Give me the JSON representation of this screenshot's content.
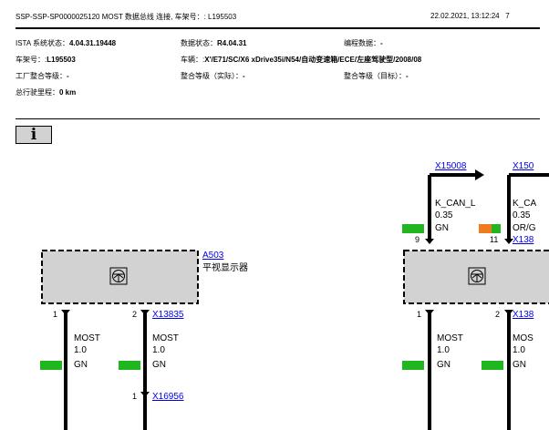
{
  "header": {
    "title": "SSP-SSP-SP0000025120 MOST 数据总线 连接, 车架号：: L195503",
    "datetime": "22.02.2021, 13:12:24",
    "page": "7"
  },
  "info": {
    "ista_label": "ISTA 系统状态：",
    "ista_value": "4.04.31.19448",
    "data_label": "数据状态：",
    "data_value": "R4.04.31",
    "prog_label": "编程数据：",
    "prog_value": "-",
    "vin_label": "车架号：:",
    "vin_value": "L195503",
    "vehicle_label": "车辆：:",
    "vehicle_value": "X'/E71/SC/X6 xDrive35i/N54/自动变速箱/ECE/左座驾驶型/2008/08",
    "factory_label": "工厂整合等级：",
    "factory_value": "-",
    "actual_label": "整合等级（实际）：",
    "actual_value": "-",
    "target_label": "整合等级（目标）：",
    "target_value": "-",
    "mileage_label": "总行驶里程：",
    "mileage_value": "0 km"
  },
  "info_icon": "i",
  "diagram": {
    "colors": {
      "green": "#1fb61f",
      "orange": "#f07a1e",
      "box_fill": "#d2d2d2"
    },
    "component": {
      "id": "A503",
      "name": "平视显示器"
    },
    "left_connector": "X13835",
    "left_lower_connector": "X16956",
    "left_pins": {
      "p1": "1",
      "p2": "2",
      "lower": "1"
    },
    "wire_left_1": {
      "signal": "MOST",
      "gauge": "1.0",
      "color": "GN"
    },
    "wire_left_2": {
      "signal": "MOST",
      "gauge": "1.0",
      "color": "GN"
    },
    "right_top_connector": "X15008",
    "right_top_connector_2": "X150",
    "right_pins": {
      "p9": "9",
      "p11": "11",
      "p1": "1",
      "p2": "2"
    },
    "kcan_1": {
      "signal": "K_CAN_L",
      "gauge": "0.35",
      "color": "GN"
    },
    "kcan_2": {
      "signal": "K_CA",
      "gauge": "0.35",
      "color": "OR/G"
    },
    "right_link_1": "X138",
    "right_lower_connector": "X138",
    "wire_right_1": {
      "signal": "MOST",
      "gauge": "1.0",
      "color": "GN"
    },
    "wire_right_2": {
      "signal": "MOS",
      "gauge": "1.0",
      "color": "GN"
    }
  }
}
